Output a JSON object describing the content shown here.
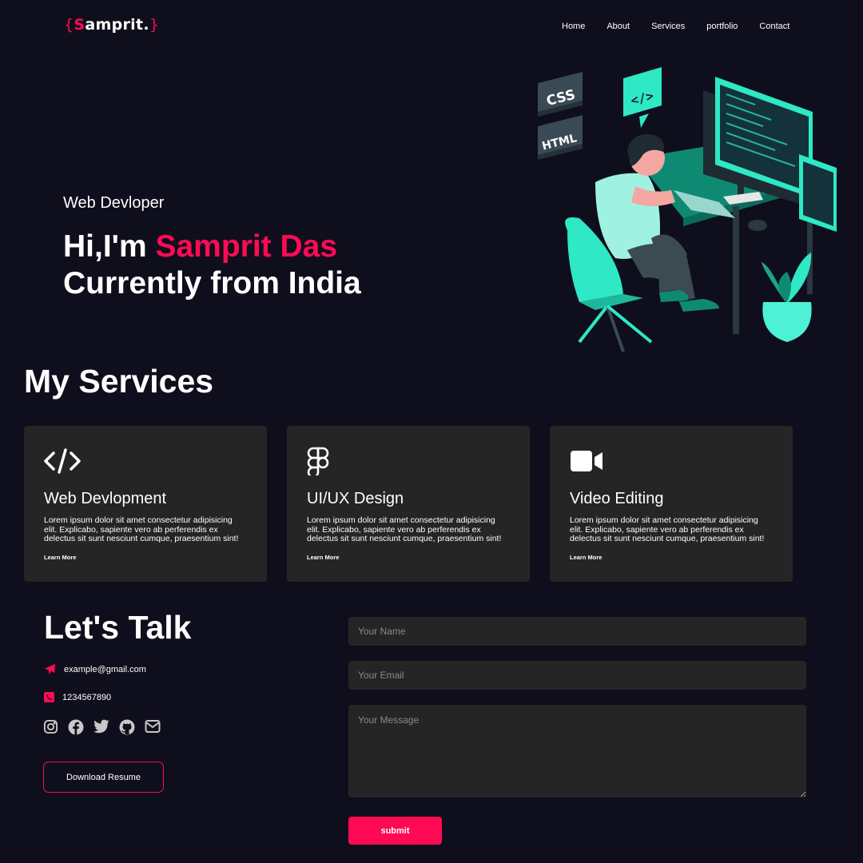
{
  "brand": {
    "open": "{",
    "initial": "S",
    "rest": "amprit",
    "dot": ".",
    "close": "}"
  },
  "nav": [
    "Home",
    "About",
    "Services",
    "portfolio",
    "Contact"
  ],
  "hero": {
    "subtitle": "Web Devloper",
    "greeting": "Hi,I'm ",
    "name": "Samprit Das",
    "line2": "Currently from India"
  },
  "illustration": {
    "badge_css": "CSS",
    "badge_html": "HTML",
    "badge_code": "</>"
  },
  "services": {
    "title": "My Services",
    "items": [
      {
        "icon": "code-icon",
        "title": "Web Devlopment",
        "text": "Lorem ipsum dolor sit amet consectetur adipisicing elit. Explicabo, sapiente vero ab perferendis ex delectus sit sunt nesciunt cumque, praesentium sint!",
        "link": "Learn More"
      },
      {
        "icon": "figma-icon",
        "title": "UI/UX Design",
        "text": "Lorem ipsum dolor sit amet consectetur adipisicing elit. Explicabo, sapiente vero ab perferendis ex delectus sit sunt nesciunt cumque, praesentium sint!",
        "link": "Learn More"
      },
      {
        "icon": "video-icon",
        "title": "Video Editing",
        "text": "Lorem ipsum dolor sit amet consectetur adipisicing elit. Explicabo, sapiente vero ab perferendis ex delectus sit sunt nesciunt cumque, praesentium sint!",
        "link": "Learn More"
      }
    ]
  },
  "contact": {
    "title": "Let's Talk",
    "email": "example@gmail.com",
    "phone": "1234567890",
    "socials": [
      "instagram-icon",
      "facebook-icon",
      "twitter-icon",
      "github-icon",
      "mail-icon"
    ],
    "resume_label": "Download Resume"
  },
  "form": {
    "name_placeholder": "Your Name",
    "email_placeholder": "Your Email",
    "message_placeholder": "Your Message",
    "submit_label": "submit"
  },
  "colors": {
    "accent": "#ff0a54",
    "background": "#0f0e1c",
    "card": "#252525",
    "illustration": "#2ee8c6"
  }
}
